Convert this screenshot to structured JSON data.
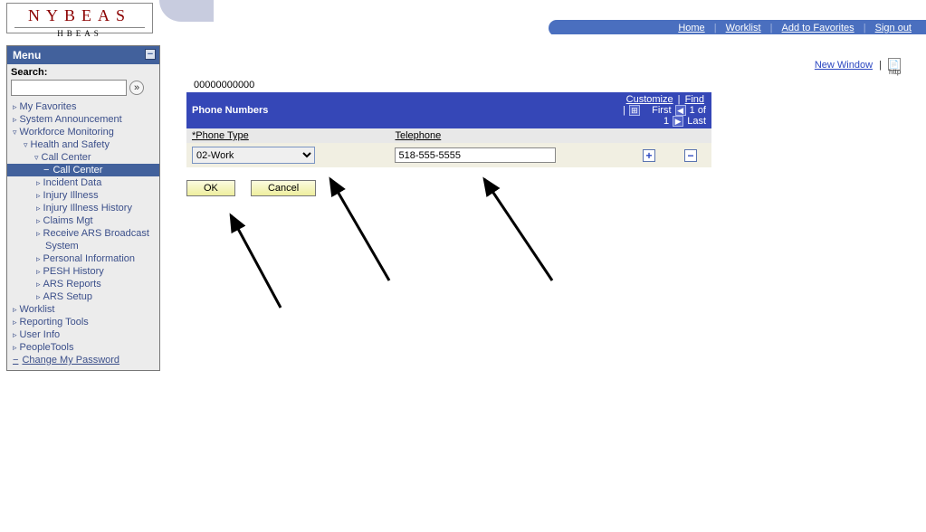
{
  "logo": {
    "line1": "NYBEAS",
    "line2": "HBEAS"
  },
  "topnav": {
    "home": "Home",
    "worklist": "Worklist",
    "add_favorites": "Add to Favorites",
    "signout": "Sign out"
  },
  "menu": {
    "title": "Menu",
    "search_label": "Search:",
    "items": {
      "my_favorites": "My Favorites",
      "system_announcement": "System Announcement",
      "workforce_monitoring": "Workforce Monitoring",
      "health_safety": "Health and Safety",
      "call_center_parent": "Call Center",
      "call_center_selected": "Call Center",
      "incident_data": "Incident Data",
      "injury_illness": "Injury Illness",
      "injury_illness_history": "Injury Illness History",
      "claims_mgt": "Claims Mgt",
      "receive_ars": "Receive ARS Broadcast",
      "receive_ars_line2": "System",
      "personal_information": "Personal Information",
      "pesh_history": "PESH History",
      "ars_reports": "ARS Reports",
      "ars_setup": "ARS Setup",
      "worklist": "Worklist",
      "reporting_tools": "Reporting Tools",
      "user_info": "User Info",
      "peopletools": "PeopleTools",
      "change_password": "Change My Password"
    }
  },
  "content": {
    "new_window": "New Window",
    "http_label": "http",
    "record_id": "00000000000",
    "grid": {
      "title": "Phone Numbers",
      "customize": "Customize",
      "find": "Find",
      "first": "First",
      "counter": "1 of 1",
      "last": "Last",
      "col_phone_type": "*Phone Type",
      "col_telephone": "Telephone",
      "phone_type_value": "02-Work",
      "telephone_value": "518-555-5555"
    },
    "ok": "OK",
    "cancel": "Cancel"
  }
}
